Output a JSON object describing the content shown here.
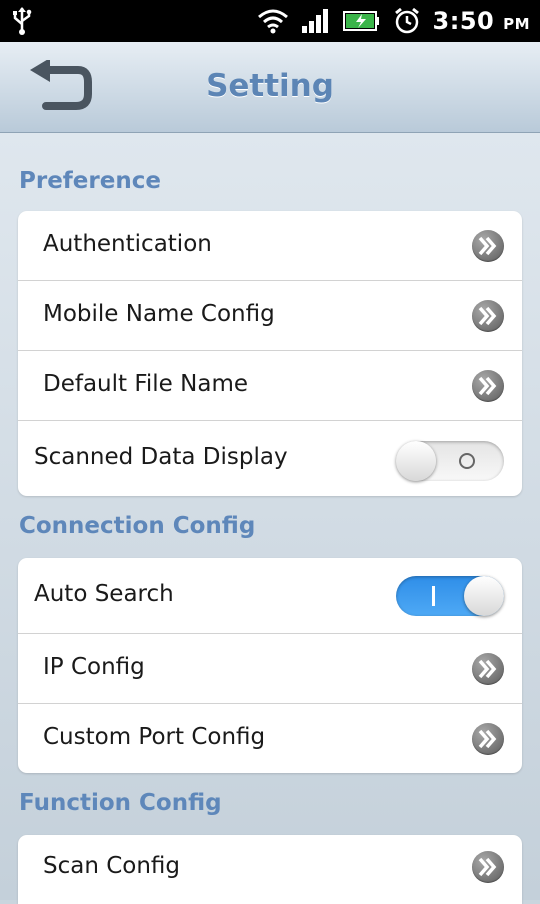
{
  "status_bar": {
    "time": "3:50",
    "ampm": "PM",
    "icons": [
      "usb-icon",
      "wifi-icon",
      "signal-icon",
      "battery-charging-icon",
      "alarm-icon"
    ]
  },
  "header": {
    "title": "Setting",
    "back_icon": "back-arrow-icon"
  },
  "sections": [
    {
      "title": "Preference",
      "items": [
        {
          "label": "Authentication",
          "control": "arrow"
        },
        {
          "label": "Mobile Name Config",
          "control": "arrow"
        },
        {
          "label": "Default File Name",
          "control": "arrow"
        },
        {
          "label": "Scanned Data Display",
          "control": "toggle",
          "state": "off",
          "state_mark": "O"
        }
      ]
    },
    {
      "title": "Connection Config",
      "items": [
        {
          "label": "Auto Search",
          "control": "toggle",
          "state": "on",
          "state_mark": "I"
        },
        {
          "label": "IP Config",
          "control": "arrow"
        },
        {
          "label": "Custom Port Config",
          "control": "arrow"
        }
      ]
    },
    {
      "title": "Function Config",
      "items": [
        {
          "label": "Scan Config",
          "control": "arrow"
        }
      ]
    }
  ],
  "colors": {
    "accent": "#5e87ba",
    "toggle_on": "#3a9bef",
    "background": "#c9d5de"
  }
}
